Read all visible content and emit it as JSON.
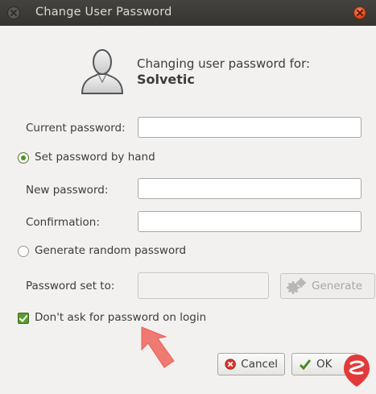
{
  "window": {
    "title": "Change User Password"
  },
  "header": {
    "line1": "Changing user password for:",
    "username": "Solvetic"
  },
  "form": {
    "current_password_label": "Current password:",
    "current_password_value": "",
    "set_by_hand_label": "Set password by hand",
    "new_password_label": "New password:",
    "new_password_value": "",
    "confirmation_label": "Confirmation:",
    "confirmation_value": "",
    "generate_random_label": "Generate random password",
    "password_set_to_label": "Password set to:",
    "password_set_to_value": "",
    "generate_button_label": "Generate",
    "dont_ask_label": "Don't ask for password on login"
  },
  "state": {
    "set_by_hand_selected": true,
    "dont_ask_checked": true
  },
  "footer": {
    "cancel_label": "Cancel",
    "ok_label": "OK"
  },
  "colors": {
    "accent_green": "#5a9b2f",
    "close_orange": "#df4a1e",
    "annotation_arrow": "#f07a72"
  },
  "icons": [
    "close-icon",
    "user-avatar-icon",
    "gear-icon",
    "cancel-icon",
    "ok-check-icon",
    "arrow-annotation-icon",
    "watermark-logo-icon"
  ]
}
